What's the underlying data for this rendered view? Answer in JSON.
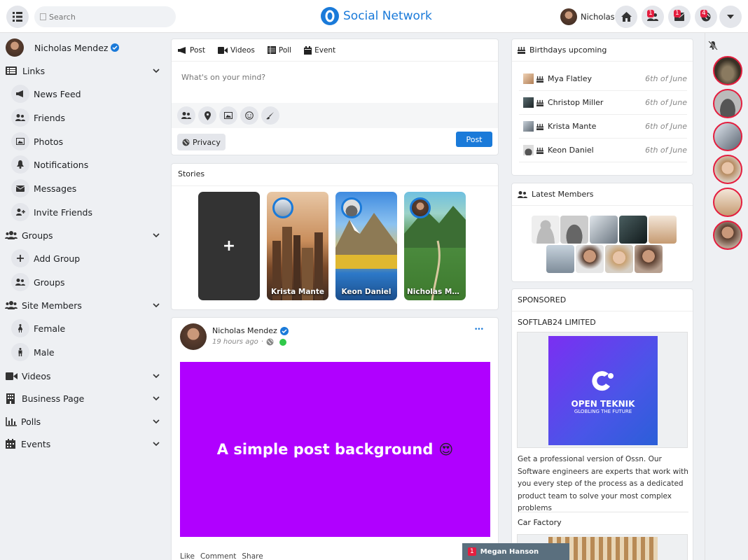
{
  "topbar": {
    "search_placeholder": "Search",
    "brand": "Social Network",
    "user_name": "Nicholas",
    "badges": [
      "1",
      "1",
      "4"
    ]
  },
  "sidebar": {
    "profile_name": "Nicholas Mendez",
    "sections": [
      {
        "label": "Links",
        "items": [
          {
            "label": "News Feed",
            "icon": "megaphone-icon"
          },
          {
            "label": "Friends",
            "icon": "users-icon"
          },
          {
            "label": "Photos",
            "icon": "image-icon"
          },
          {
            "label": "Notifications",
            "icon": "bell-icon"
          },
          {
            "label": "Messages",
            "icon": "envelope-icon"
          },
          {
            "label": "Invite Friends",
            "icon": "user-plus-icon"
          }
        ]
      },
      {
        "label": "Groups",
        "items": [
          {
            "label": "Add Group",
            "icon": "plus-icon"
          },
          {
            "label": "Groups",
            "icon": "users-icon"
          }
        ]
      },
      {
        "label": "Site Members",
        "items": [
          {
            "label": "Female",
            "icon": "female-icon"
          },
          {
            "label": "Male",
            "icon": "male-icon"
          }
        ]
      },
      {
        "label": "Videos",
        "items": []
      },
      {
        "label": "Business Page",
        "items": []
      },
      {
        "label": "Polls",
        "items": []
      },
      {
        "label": "Events",
        "items": []
      }
    ]
  },
  "composer": {
    "tabs": [
      "Post",
      "Videos",
      "Poll",
      "Event"
    ],
    "placeholder": "What's on your mind?",
    "privacy_label": "Privacy",
    "post_label": "Post"
  },
  "stories": {
    "title": "Stories",
    "add_symbol": "+",
    "items": [
      {
        "name": "Krista Mante"
      },
      {
        "name": "Keon Daniel"
      },
      {
        "name": "Nicholas Men..."
      }
    ]
  },
  "post": {
    "author": "Nicholas Mendez",
    "time": "19 hours ago",
    "separator": "·",
    "menu_dots": "•••",
    "text": "A simple post background",
    "emoji": "😍",
    "background_color": "#b000ff",
    "actions": [
      "Like",
      "Comment",
      "Share"
    ]
  },
  "birthdays": {
    "title": "Birthdays upcoming",
    "items": [
      {
        "name": "Mya Flatley",
        "date": "6th of June"
      },
      {
        "name": "Christop Miller",
        "date": "6th of June"
      },
      {
        "name": "Krista Mante",
        "date": "6th of June"
      },
      {
        "name": "Keon Daniel",
        "date": "6th of June"
      }
    ]
  },
  "latest_members": {
    "title": "Latest Members"
  },
  "sponsored": {
    "title": "SPONSORED",
    "ad1_title": "SOFTLAB24 LIMITED",
    "ad1_brand": "OPEN TEKNIK",
    "ad1_tagline": "GLOBLING THE FUTURE",
    "ad1_desc": "Get a professional version of Ossn. Our Software engineers are experts that work with you every step of the process as a dedicated product team to solve your most complex problems",
    "ad2_title": "Car Factory"
  },
  "chat": {
    "badge": "1",
    "name": "Megan Hanson"
  },
  "colors": {
    "accent": "#1a7ad9",
    "badge_red": "#e41e3f"
  }
}
